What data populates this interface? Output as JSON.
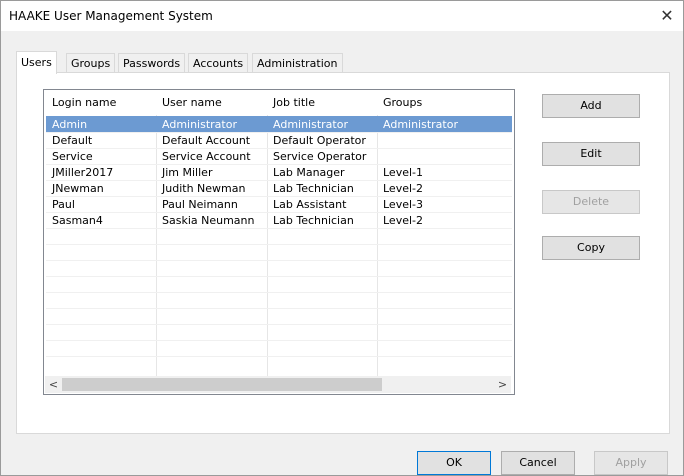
{
  "window": {
    "title": "HAAKE User Management System",
    "close_label": "✕"
  },
  "tabs": [
    {
      "label": "Users"
    },
    {
      "label": "Groups"
    },
    {
      "label": "Passwords"
    },
    {
      "label": "Accounts"
    },
    {
      "label": "Administration"
    }
  ],
  "users_table": {
    "columns": [
      "Login name",
      "User name",
      "Job title",
      "Groups"
    ],
    "rows": [
      [
        "Admin",
        "Administrator",
        "Administrator",
        "Administrator"
      ],
      [
        "Default",
        "Default Account",
        "Default Operator",
        ""
      ],
      [
        "Service",
        "Service Account",
        "Service Operator",
        ""
      ],
      [
        "JMiller2017",
        "Jim Miller",
        "Lab Manager",
        "Level-1"
      ],
      [
        "JNewman",
        "Judith Newman",
        "Lab Technician",
        "Level-2"
      ],
      [
        "Paul",
        "Paul Neimann",
        "Lab Assistant",
        "Level-3"
      ],
      [
        "Sasman4",
        "Saskia Neumann",
        "Lab Technician",
        "Level-2"
      ]
    ],
    "selected_row": 0,
    "scroll_left_label": "<",
    "scroll_right_label": ">"
  },
  "side_buttons": {
    "add": "Add",
    "edit": "Edit",
    "delete": "Delete",
    "copy": "Copy"
  },
  "footer_buttons": {
    "ok": "OK",
    "cancel": "Cancel",
    "apply": "Apply"
  },
  "colors": {
    "selection": "#6c9ad2",
    "default_button_border": "#0078d7"
  }
}
